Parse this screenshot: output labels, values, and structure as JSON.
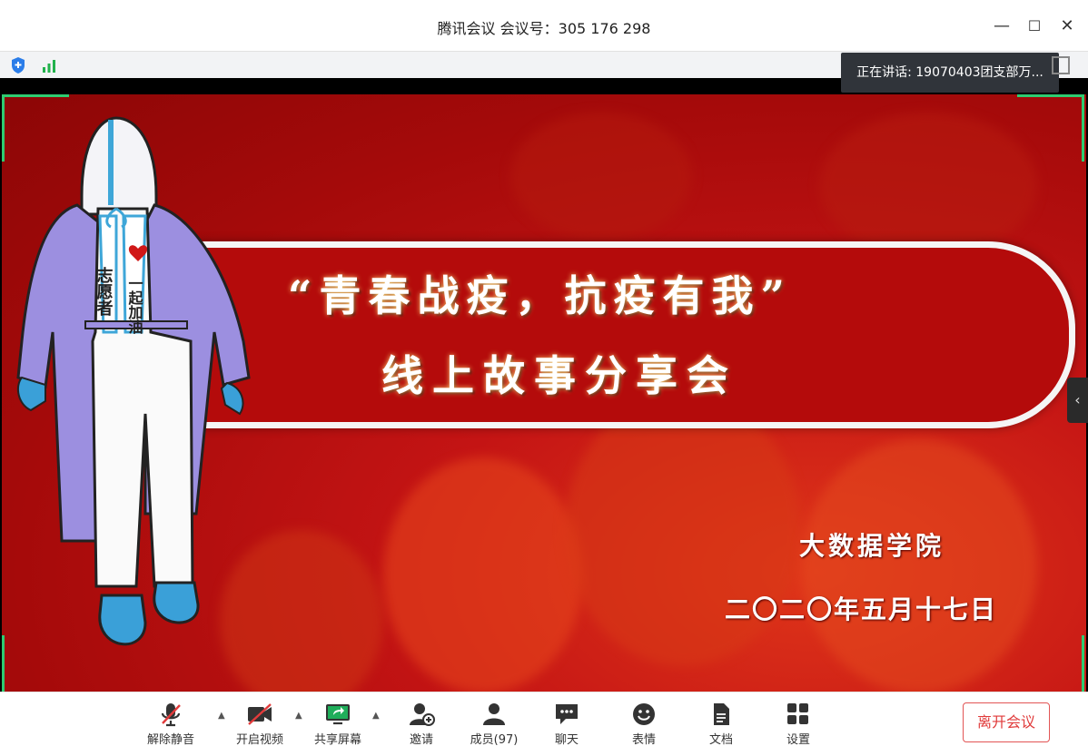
{
  "window": {
    "title": "腾讯会议 会议号：305 176 298",
    "controls": {
      "minimize": "—",
      "maximize": "☐",
      "close": "✕"
    }
  },
  "status": {
    "speaker_text": "正在讲话: 19070403团支部万..."
  },
  "slide": {
    "headline_line1": "“青春战疫，抗疫有我”",
    "headline_line2": "线上故事分享会",
    "college": "大数据学院",
    "date": "二〇二〇年五月十七日",
    "figure_text_1": "志愿者",
    "figure_text_2": "一起加油"
  },
  "toolbar": {
    "unmute": "解除静音",
    "start_video": "开启视频",
    "share_screen": "共享屏幕",
    "invite": "邀请",
    "members": "成员(97)",
    "chat": "聊天",
    "reactions": "表情",
    "docs": "文档",
    "settings": "设置",
    "leave": "离开会议"
  },
  "colors": {
    "accent_green": "#2ecc71",
    "leave_red": "#e03a3a",
    "slide_red": "#b40b0b"
  }
}
